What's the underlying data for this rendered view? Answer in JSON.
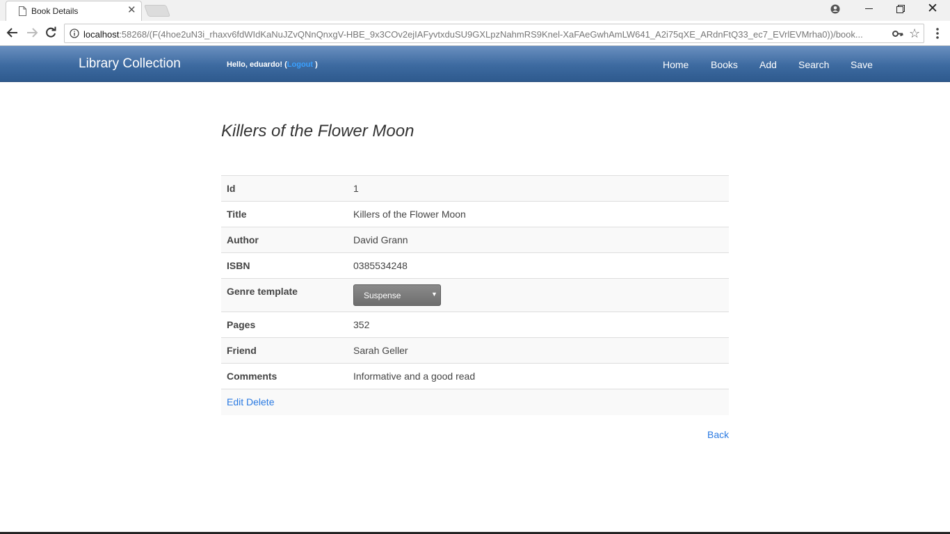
{
  "browser": {
    "tab_title": "Book Details",
    "url_host": "localhost",
    "url_rest": ":58268/(F(4hoe2uN3i_rhaxv6fdWIdKaNuJZvQNnQnxgV-HBE_9x3COv2ejIAFyvtxduSU9GXLpzNahmRS9Knel-XaFAeGwhAmLW641_A2i75qXE_ARdnFtQ33_ec7_EVrlEVMrha0))/book..."
  },
  "navbar": {
    "brand": "Library Collection",
    "hello_text": "Hello, eduardo! (",
    "logout_label": "Logout",
    "hello_close": " )",
    "links": [
      "Home",
      "Books",
      "Add",
      "Search",
      "Save"
    ]
  },
  "page": {
    "title": "Killers of the Flower Moon",
    "back_label": "Back"
  },
  "details": {
    "id_label": "Id",
    "id_value": "1",
    "title_label": "Title",
    "title_value": "Killers of the Flower Moon",
    "author_label": "Author",
    "author_value": "David Grann",
    "isbn_label": "ISBN",
    "isbn_value": "0385534248",
    "genre_label": "Genre template",
    "genre_value": "Suspense",
    "pages_label": "Pages",
    "pages_value": "352",
    "friend_label": "Friend",
    "friend_value": "Sarah Geller",
    "comments_label": "Comments",
    "comments_value": "Informative and a good read",
    "edit_label": "Edit",
    "delete_label": "Delete"
  }
}
